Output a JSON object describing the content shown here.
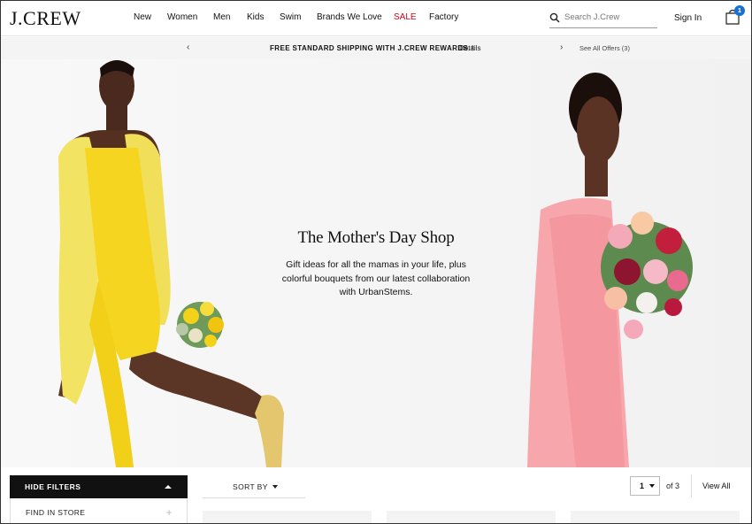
{
  "header": {
    "logo": "J.CREW",
    "nav": [
      {
        "label": "New"
      },
      {
        "label": "Women"
      },
      {
        "label": "Men"
      },
      {
        "label": "Kids"
      },
      {
        "label": "Swim"
      },
      {
        "label": "Brands We Love"
      },
      {
        "label": "SALE"
      },
      {
        "label": "Factory"
      }
    ],
    "search_placeholder": "Search J.Crew",
    "sign_in": "Sign In",
    "bag_count": "1",
    "sale_color": "#d0021b",
    "badge_color": "#1a6fd1"
  },
  "promo": {
    "message": "FREE STANDARD SHIPPING WITH J.CREW REWARDS.",
    "dagger": "†",
    "details": "Details",
    "offers": "See All Offers (3)"
  },
  "hero": {
    "title": "The Mother's Day Shop",
    "body": "Gift ideas for all the mamas in your life, plus colorful bouquets from our latest collaboration with UrbanStems."
  },
  "filters": {
    "hide_filters": "HIDE FILTERS",
    "find_in_store": "FIND IN STORE",
    "sort_by": "SORT BY",
    "page": "1",
    "of_total": "of 3",
    "view_all": "View All"
  }
}
